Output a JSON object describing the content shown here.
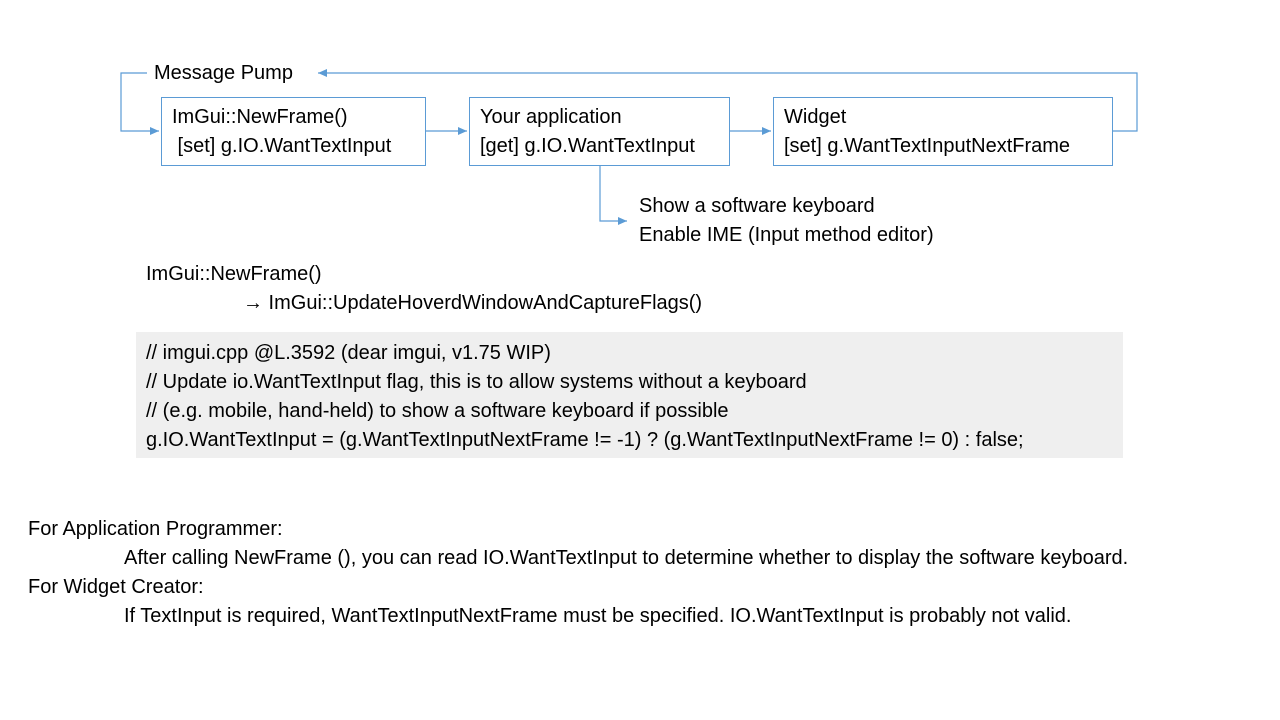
{
  "diagram": {
    "loop_label": "Message Pump",
    "boxes": [
      {
        "line1": "ImGui::NewFrame()",
        "line2": " [set] g.IO.WantTextInput"
      },
      {
        "line1": "Your application",
        "line2": "[get] g.IO.WantTextInput"
      },
      {
        "line1": "Widget",
        "line2": "[set] g.WantTextInputNextFrame"
      }
    ],
    "branch_text": [
      "Show a software keyboard",
      "Enable IME (Input method editor)"
    ],
    "colors": {
      "connector": "#5b9bd5",
      "code_bg": "#efefef"
    }
  },
  "call_chain": {
    "caller": "ImGui::NewFrame()",
    "callee": "→ ImGui::UpdateHoverdWindowAndCaptureFlags()"
  },
  "code": {
    "lines": [
      "// imgui.cpp @L.3592 (dear imgui, v1.75 WIP)",
      "// Update io.WantTextInput flag, this is to allow systems without a keyboard",
      "// (e.g. mobile, hand-held) to show a software keyboard if possible",
      "g.IO.WantTextInput = (g.WantTextInputNextFrame != -1) ? (g.WantTextInputNextFrame != 0) : false;"
    ]
  },
  "notes": {
    "app_heading": "For Application Programmer:",
    "app_text": "After calling NewFrame (), you can read IO.WantTextInput to determine whether to display the software keyboard.",
    "widget_heading": "For Widget Creator:",
    "widget_text": "If TextInput is required, WantTextInputNextFrame must be specified. IO.WantTextInput is probably not valid."
  }
}
